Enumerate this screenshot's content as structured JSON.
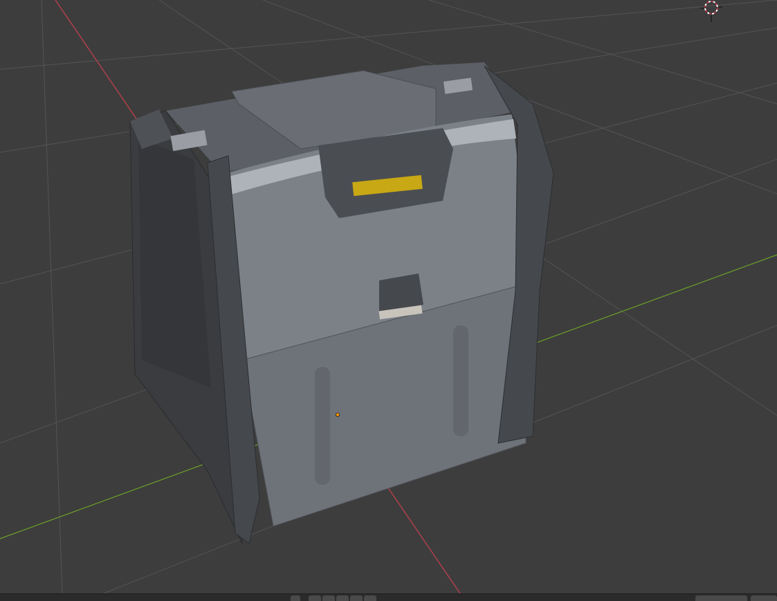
{
  "viewport": {
    "background_color": "#3d3d3d",
    "grid_color": "#545454",
    "x_axis_color": "#c0404a",
    "y_axis_color": "#6a9a2a",
    "cursor_icon": "3d-cursor-icon",
    "origin_icon": "object-origin-icon",
    "origin_color": "#ff9900"
  },
  "model": {
    "body_color": "#7a7f86",
    "frame_color": "#45484c",
    "handle_accent_color": "#c8a814"
  }
}
